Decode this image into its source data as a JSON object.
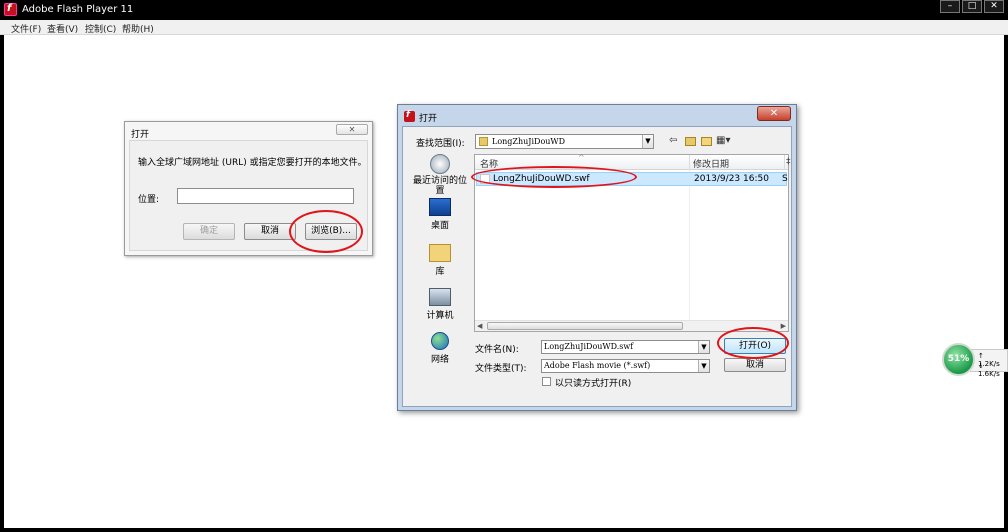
{
  "window": {
    "title": "Adobe Flash Player 11",
    "app_icon_glyph": "f",
    "controls": [
      "–",
      "□",
      "✕"
    ]
  },
  "menu": [
    "文件(F)",
    "查看(V)",
    "控制(C)",
    "帮助(H)"
  ],
  "open_url_dialog": {
    "title": "打开",
    "close_glyph": "✕",
    "prompt": "输入全球广域网地址 (URL) 或指定您要打开的本地文件。",
    "location_label": "位置:",
    "location_value": "",
    "ok_label": "确定",
    "cancel_label": "取消",
    "browse_label": "浏览(B)..."
  },
  "file_dialog": {
    "title": "打开",
    "close_glyph": "✕",
    "look_in_label": "查找范围(I):",
    "look_in_value": "LongZhuJiDouWD",
    "toolbar_icons": [
      "back-icon",
      "up-folder-icon",
      "new-folder-icon",
      "view-menu-icon"
    ],
    "places": [
      {
        "label": "最近访问的位置",
        "icon": "recent-places-icon"
      },
      {
        "label": "桌面",
        "icon": "desktop-icon"
      },
      {
        "label": "库",
        "icon": "libraries-icon"
      },
      {
        "label": "计算机",
        "icon": "computer-icon"
      },
      {
        "label": "网络",
        "icon": "network-icon"
      }
    ],
    "columns": [
      "名称",
      "修改日期",
      "‡"
    ],
    "files": [
      {
        "name": "LongZhuJiDouWD.swf",
        "modified": "2013/9/23 16:50",
        "extra": "S",
        "selected": true
      }
    ],
    "filename_label": "文件名(N):",
    "filename_value": "LongZhuJiDouWD.swf",
    "filetype_label": "文件类型(T):",
    "filetype_value": "Adobe Flash movie (*.swf)",
    "readonly_label": "以只读方式打开(R)",
    "readonly_checked": false,
    "open_label": "打开(O)",
    "cancel_label": "取消"
  },
  "net_widget": {
    "percent": "51%",
    "up": "1.2K/s",
    "down": "1.6K/s"
  },
  "colors": {
    "annotation": "#e0141b",
    "selection": "#cce8ff",
    "dialog_frame": "#c6d6ea"
  }
}
